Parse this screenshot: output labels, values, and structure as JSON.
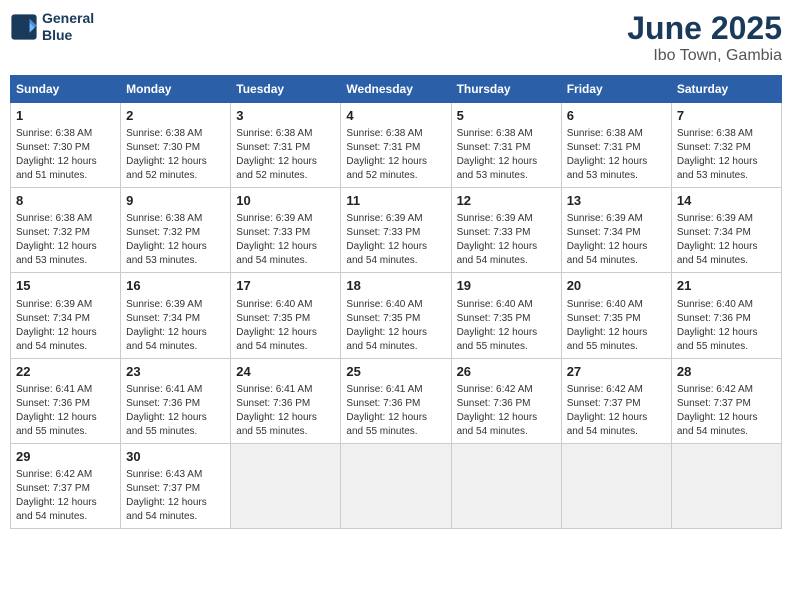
{
  "logo": {
    "line1": "General",
    "line2": "Blue"
  },
  "title": "June 2025",
  "location": "Ibo Town, Gambia",
  "headers": [
    "Sunday",
    "Monday",
    "Tuesday",
    "Wednesday",
    "Thursday",
    "Friday",
    "Saturday"
  ],
  "weeks": [
    [
      {
        "day": "1",
        "info": "Sunrise: 6:38 AM\nSunset: 7:30 PM\nDaylight: 12 hours\nand 51 minutes."
      },
      {
        "day": "2",
        "info": "Sunrise: 6:38 AM\nSunset: 7:30 PM\nDaylight: 12 hours\nand 52 minutes."
      },
      {
        "day": "3",
        "info": "Sunrise: 6:38 AM\nSunset: 7:31 PM\nDaylight: 12 hours\nand 52 minutes."
      },
      {
        "day": "4",
        "info": "Sunrise: 6:38 AM\nSunset: 7:31 PM\nDaylight: 12 hours\nand 52 minutes."
      },
      {
        "day": "5",
        "info": "Sunrise: 6:38 AM\nSunset: 7:31 PM\nDaylight: 12 hours\nand 53 minutes."
      },
      {
        "day": "6",
        "info": "Sunrise: 6:38 AM\nSunset: 7:31 PM\nDaylight: 12 hours\nand 53 minutes."
      },
      {
        "day": "7",
        "info": "Sunrise: 6:38 AM\nSunset: 7:32 PM\nDaylight: 12 hours\nand 53 minutes."
      }
    ],
    [
      {
        "day": "8",
        "info": "Sunrise: 6:38 AM\nSunset: 7:32 PM\nDaylight: 12 hours\nand 53 minutes."
      },
      {
        "day": "9",
        "info": "Sunrise: 6:38 AM\nSunset: 7:32 PM\nDaylight: 12 hours\nand 53 minutes."
      },
      {
        "day": "10",
        "info": "Sunrise: 6:39 AM\nSunset: 7:33 PM\nDaylight: 12 hours\nand 54 minutes."
      },
      {
        "day": "11",
        "info": "Sunrise: 6:39 AM\nSunset: 7:33 PM\nDaylight: 12 hours\nand 54 minutes."
      },
      {
        "day": "12",
        "info": "Sunrise: 6:39 AM\nSunset: 7:33 PM\nDaylight: 12 hours\nand 54 minutes."
      },
      {
        "day": "13",
        "info": "Sunrise: 6:39 AM\nSunset: 7:34 PM\nDaylight: 12 hours\nand 54 minutes."
      },
      {
        "day": "14",
        "info": "Sunrise: 6:39 AM\nSunset: 7:34 PM\nDaylight: 12 hours\nand 54 minutes."
      }
    ],
    [
      {
        "day": "15",
        "info": "Sunrise: 6:39 AM\nSunset: 7:34 PM\nDaylight: 12 hours\nand 54 minutes."
      },
      {
        "day": "16",
        "info": "Sunrise: 6:39 AM\nSunset: 7:34 PM\nDaylight: 12 hours\nand 54 minutes."
      },
      {
        "day": "17",
        "info": "Sunrise: 6:40 AM\nSunset: 7:35 PM\nDaylight: 12 hours\nand 54 minutes."
      },
      {
        "day": "18",
        "info": "Sunrise: 6:40 AM\nSunset: 7:35 PM\nDaylight: 12 hours\nand 54 minutes."
      },
      {
        "day": "19",
        "info": "Sunrise: 6:40 AM\nSunset: 7:35 PM\nDaylight: 12 hours\nand 55 minutes."
      },
      {
        "day": "20",
        "info": "Sunrise: 6:40 AM\nSunset: 7:35 PM\nDaylight: 12 hours\nand 55 minutes."
      },
      {
        "day": "21",
        "info": "Sunrise: 6:40 AM\nSunset: 7:36 PM\nDaylight: 12 hours\nand 55 minutes."
      }
    ],
    [
      {
        "day": "22",
        "info": "Sunrise: 6:41 AM\nSunset: 7:36 PM\nDaylight: 12 hours\nand 55 minutes."
      },
      {
        "day": "23",
        "info": "Sunrise: 6:41 AM\nSunset: 7:36 PM\nDaylight: 12 hours\nand 55 minutes."
      },
      {
        "day": "24",
        "info": "Sunrise: 6:41 AM\nSunset: 7:36 PM\nDaylight: 12 hours\nand 55 minutes."
      },
      {
        "day": "25",
        "info": "Sunrise: 6:41 AM\nSunset: 7:36 PM\nDaylight: 12 hours\nand 55 minutes."
      },
      {
        "day": "26",
        "info": "Sunrise: 6:42 AM\nSunset: 7:36 PM\nDaylight: 12 hours\nand 54 minutes."
      },
      {
        "day": "27",
        "info": "Sunrise: 6:42 AM\nSunset: 7:37 PM\nDaylight: 12 hours\nand 54 minutes."
      },
      {
        "day": "28",
        "info": "Sunrise: 6:42 AM\nSunset: 7:37 PM\nDaylight: 12 hours\nand 54 minutes."
      }
    ],
    [
      {
        "day": "29",
        "info": "Sunrise: 6:42 AM\nSunset: 7:37 PM\nDaylight: 12 hours\nand 54 minutes."
      },
      {
        "day": "30",
        "info": "Sunrise: 6:43 AM\nSunset: 7:37 PM\nDaylight: 12 hours\nand 54 minutes."
      },
      {
        "day": "",
        "info": ""
      },
      {
        "day": "",
        "info": ""
      },
      {
        "day": "",
        "info": ""
      },
      {
        "day": "",
        "info": ""
      },
      {
        "day": "",
        "info": ""
      }
    ]
  ]
}
